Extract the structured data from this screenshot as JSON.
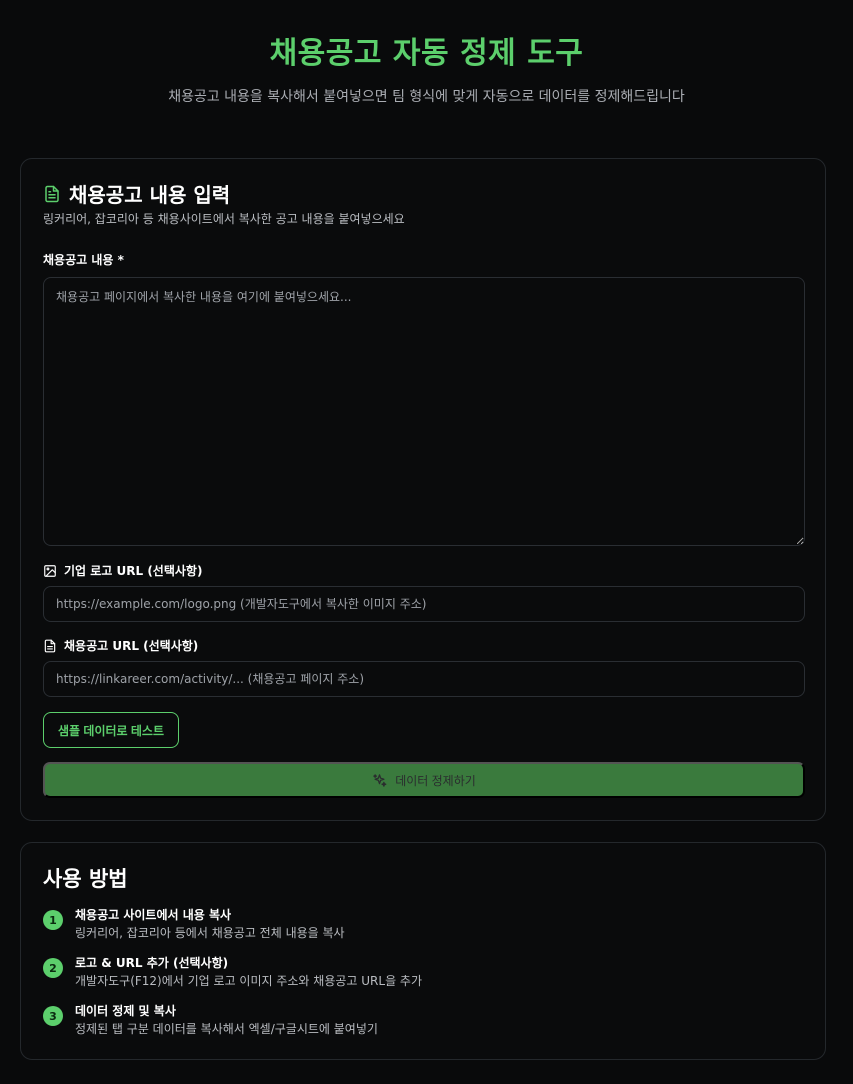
{
  "header": {
    "title": "채용공고 자동 정제 도구",
    "subtitle": "채용공고 내용을 복사해서 붙여넣으면 팀 형식에 맞게 자동으로 데이터를 정제해드립니다"
  },
  "input_card": {
    "title": "채용공고 내용 입력",
    "description": "링커리어, 잡코리아 등 채용사이트에서 복사한 공고 내용을 붙여넣으세요",
    "content_label": "채용공고 내용 *",
    "content_placeholder": "채용공고 페이지에서 복사한 내용을 여기에 붙여넣으세요...",
    "content_value": "",
    "logo_label": "기업 로고 URL (선택사항)",
    "logo_placeholder": "https://example.com/logo.png (개발자도구에서 복사한 이미지 주소)",
    "logo_value": "",
    "url_label": "채용공고 URL (선택사항)",
    "url_placeholder": "https://linkareer.com/activity/... (채용공고 페이지 주소)",
    "url_value": "",
    "sample_button": "샘플 데이터로 테스트",
    "submit_button": "데이터 정제하기"
  },
  "howto": {
    "title": "사용 방법",
    "steps": [
      {
        "num": "1",
        "title": "채용공고 사이트에서 내용 복사",
        "desc": "링커리어, 잡코리아 등에서 채용공고 전체 내용을 복사"
      },
      {
        "num": "2",
        "title": "로고 & URL 추가 (선택사항)",
        "desc": "개발자도구(F12)에서 기업 로고 이미지 주소와 채용공고 URL을 추가"
      },
      {
        "num": "3",
        "title": "데이터 정제 및 복사",
        "desc": "정제된 탭 구분 데이터를 복사해서 엑셀/구글시트에 붙여넣기"
      }
    ]
  },
  "colors": {
    "accent": "#5ccf6c",
    "primary_button": "#3a7a3d",
    "background": "#090a0b",
    "card_border": "#24282c"
  },
  "icons": {
    "card_title": "file-text-icon",
    "logo_label": "image-icon",
    "url_label": "file-icon",
    "submit": "sparkles-icon"
  }
}
